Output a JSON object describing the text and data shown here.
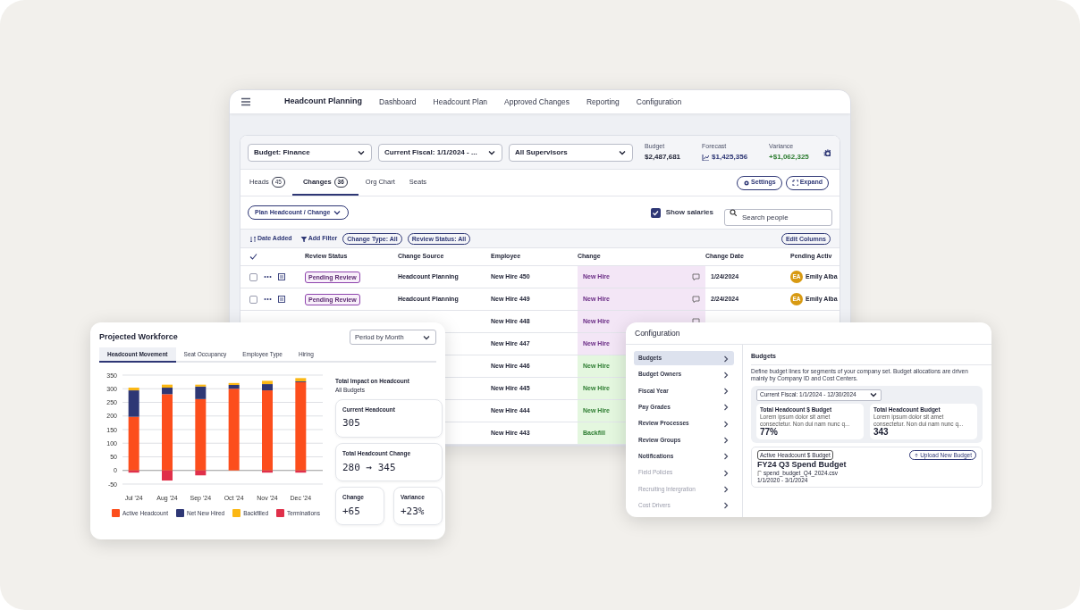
{
  "main_window": {
    "app_title": "Headcount Planning",
    "nav": [
      "Dashboard",
      "Headcount Plan",
      "Approved Changes",
      "Reporting",
      "Configuration"
    ],
    "filters": [
      "Budget: Finance",
      "Current Fiscal: 1/1/2024 - ...",
      "All Supervisors"
    ],
    "stats": [
      {
        "label": "Budget",
        "value": "$2,487,681",
        "kind": "plain"
      },
      {
        "label": "Forecast",
        "value": "$1,425,356",
        "kind": "forecast"
      },
      {
        "label": "Variance",
        "value": "+$1,062,325",
        "kind": "positive"
      }
    ],
    "tabs": [
      {
        "label": "Heads",
        "count": "45",
        "selected": false
      },
      {
        "label": "Changes",
        "count": "36",
        "selected": true
      },
      {
        "label": "Org Chart",
        "selected": false
      },
      {
        "label": "Seats",
        "selected": false
      }
    ],
    "tab_buttons": [
      "Settings",
      "Expand"
    ],
    "plan_button": "Plan Headcount / Change",
    "show_salaries": {
      "label": "Show salaries",
      "checked": true
    },
    "search": {
      "placeholder": "Search people"
    },
    "sort": "Date Added",
    "add_filter": "Add Filter",
    "chips": [
      "Change Type: All",
      "Review Status: All"
    ],
    "edit_columns": "Edit Columns",
    "table": {
      "columns": [
        "Review Status",
        "Change Source",
        "Employee",
        "Change",
        "Change Date",
        "Pending Activ"
      ],
      "rows": [
        {
          "checked": false,
          "review_status": "Pending Review",
          "source": "Headcount Planning",
          "employee": "New Hire 450",
          "change": "New Hire",
          "kind": "pending",
          "has_comment": true,
          "date": "1/24/2024",
          "avatar": "EA",
          "person": "Emily Alba"
        },
        {
          "checked": false,
          "review_status": "Pending Review",
          "source": "Headcount Planning",
          "employee": "New Hire 449",
          "change": "New Hire",
          "kind": "pending",
          "has_comment": true,
          "date": "2/24/2024",
          "avatar": "EA",
          "person": "Emily Alba"
        },
        {
          "employee": "New Hire 448",
          "change": "New Hire",
          "kind": "pending",
          "has_comment": true
        },
        {
          "employee": "New Hire 447",
          "change": "New Hire",
          "kind": "pending"
        },
        {
          "employee": "New Hire 446",
          "change": "New Hire",
          "kind": "approved"
        },
        {
          "employee": "New Hire 445",
          "change": "New Hire",
          "kind": "approved"
        },
        {
          "employee": "New Hire 444",
          "change": "New Hire",
          "kind": "approved"
        },
        {
          "employee": "New Hire 443",
          "change": "Backfill",
          "kind": "approved"
        }
      ]
    }
  },
  "workforce_card": {
    "title": "Projected Workforce",
    "period": "Period by Month",
    "tabs": [
      {
        "label": "Headcount Movement",
        "selected": true
      },
      {
        "label": "Seat Occupancy",
        "selected": false
      },
      {
        "label": "Employee Type",
        "selected": false
      },
      {
        "label": "Hiring",
        "selected": false
      }
    ],
    "chart_data": {
      "type": "bar",
      "stacked": true,
      "grid": true,
      "categories": [
        "Jul '24",
        "Aug '24",
        "Sep '24",
        "Oct '24",
        "Nov '24",
        "Dec '24"
      ],
      "ylim": [
        -50,
        350
      ],
      "yticks": [
        -50,
        0,
        50,
        100,
        150,
        200,
        250,
        300,
        350
      ],
      "series": [
        {
          "name": "Active Headcount",
          "color": "#fc4e1c",
          "values": [
            197,
            280,
            262,
            300,
            294,
            324
          ]
        },
        {
          "name": "Net New Hired",
          "color": "#2e3775",
          "values": [
            97,
            24,
            46,
            14,
            23,
            3
          ]
        },
        {
          "name": "Backfilled",
          "color": "#fbb714",
          "values": [
            10,
            11,
            7,
            7,
            12,
            12
          ]
        },
        {
          "name": "Terminations",
          "color": "#e0304a",
          "values": [
            -8,
            -37,
            -18,
            0,
            -8,
            -8
          ]
        }
      ]
    },
    "impact_title": "Total Impact on Headcount",
    "impact_subtitle": "All Budgets",
    "metrics": [
      {
        "label": "Current Headcount",
        "value": "305"
      },
      {
        "label": "Total Headcount Change",
        "value": "280 → 345"
      },
      {
        "label": "Change",
        "value": "+65"
      },
      {
        "label": "Variance",
        "value": "+23%"
      }
    ]
  },
  "config_card": {
    "title": "Configuration",
    "items": [
      {
        "label": "Budgets",
        "selected": true,
        "disabled": false
      },
      {
        "label": "Budget Owners",
        "selected": false,
        "disabled": false
      },
      {
        "label": "Fiscal Year",
        "selected": false,
        "disabled": false
      },
      {
        "label": "Pay Grades",
        "selected": false,
        "disabled": false
      },
      {
        "label": "Review Processes",
        "selected": false,
        "disabled": false
      },
      {
        "label": "Review Groups",
        "selected": false,
        "disabled": false
      },
      {
        "label": "Notifications",
        "selected": false,
        "disabled": false
      },
      {
        "label": "Field Policies",
        "selected": false,
        "disabled": true
      },
      {
        "label": "Recruiting Intergration",
        "selected": false,
        "disabled": true
      },
      {
        "label": "Cost Drivers",
        "selected": false,
        "disabled": true
      }
    ],
    "heading": "Budgets",
    "description": "Define budget lines for segments of your company set. Budget allocations are driven mainly by Company ID and Cost Centers.",
    "fiscal": "Current Fiscal: 1/1/2024 - 12/30/2024",
    "stat_cards": [
      {
        "label": "Total Headcount $ Budget",
        "note": "Lorem ipsum dolor sit amet consectetur. Non dui nam nunc q...",
        "value": "77%"
      },
      {
        "label": "Total Headcount Budget",
        "note": "Lorem ipsum dolor sit amet consectetur. Non dui nam nunc q...",
        "value": "343"
      }
    ],
    "budget": {
      "badge": "Active Headcount $ Budget",
      "upload": "Upload New Budget",
      "name": "FY24 Q3 Spend Budget",
      "file": "spend_budget_Q4_2024.csv",
      "range": "1/1/2020 - 3/1/2024"
    }
  }
}
